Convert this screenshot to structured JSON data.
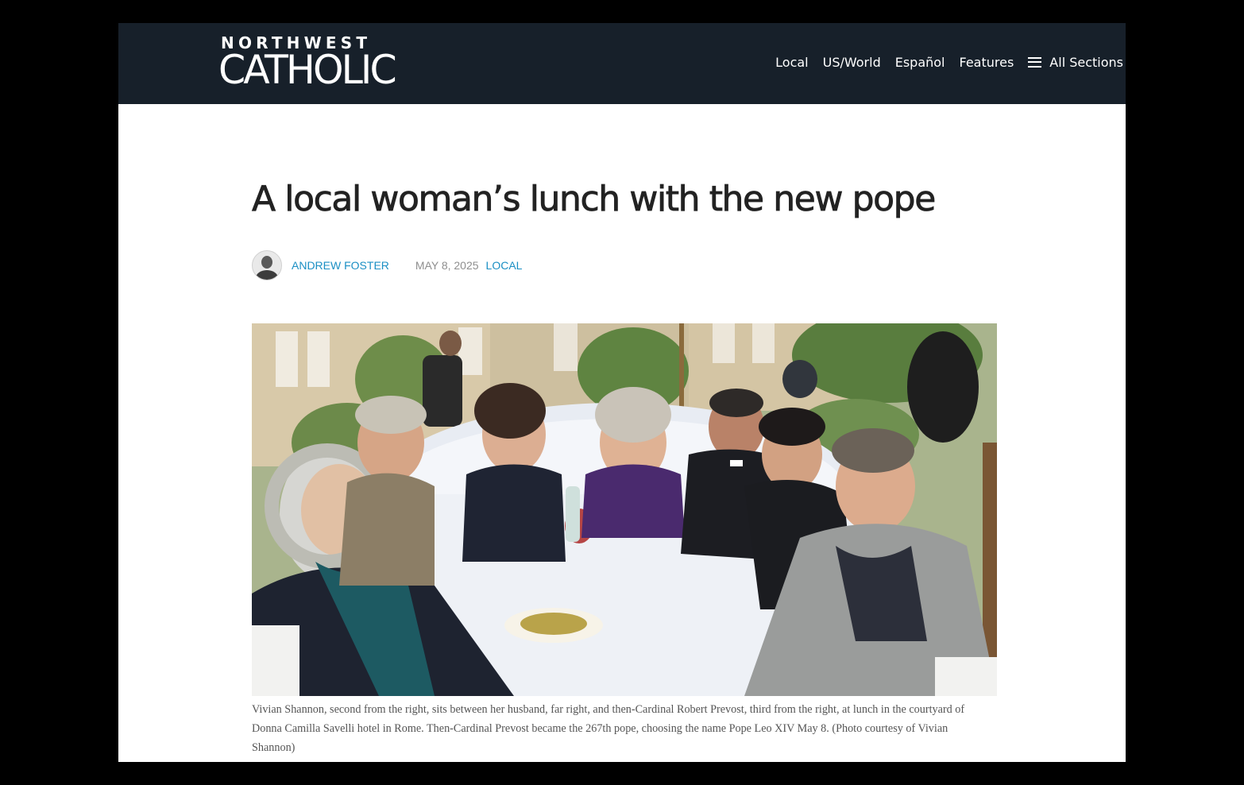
{
  "site": {
    "logo_top": "NORTHWEST",
    "logo_main": "CATHOLIC"
  },
  "nav": {
    "items": [
      "Local",
      "US/World",
      "Español",
      "Features"
    ],
    "all_sections": "All Sections",
    "all_sections_icon": "hamburger-menu-icon"
  },
  "article": {
    "title": "A local woman’s lunch with the new pope",
    "author": "ANDREW FOSTER",
    "date": "MAY 8, 2025",
    "category": "LOCAL",
    "caption": "Vivian Shannon, second from the right, sits between her husband, far right, and then-Cardinal Robert Prevost, third from the right, at lunch in the courtyard of Donna Camilla Savelli hotel in Rome. Then-Cardinal Prevost became the 267th pope, choosing the name Pope Leo XIV May 8. (Photo courtesy of Vivian Shannon)"
  },
  "colors": {
    "masthead": "#17202a",
    "link": "#1b8fc4",
    "headline": "#222222",
    "date": "#8f8f8f"
  }
}
